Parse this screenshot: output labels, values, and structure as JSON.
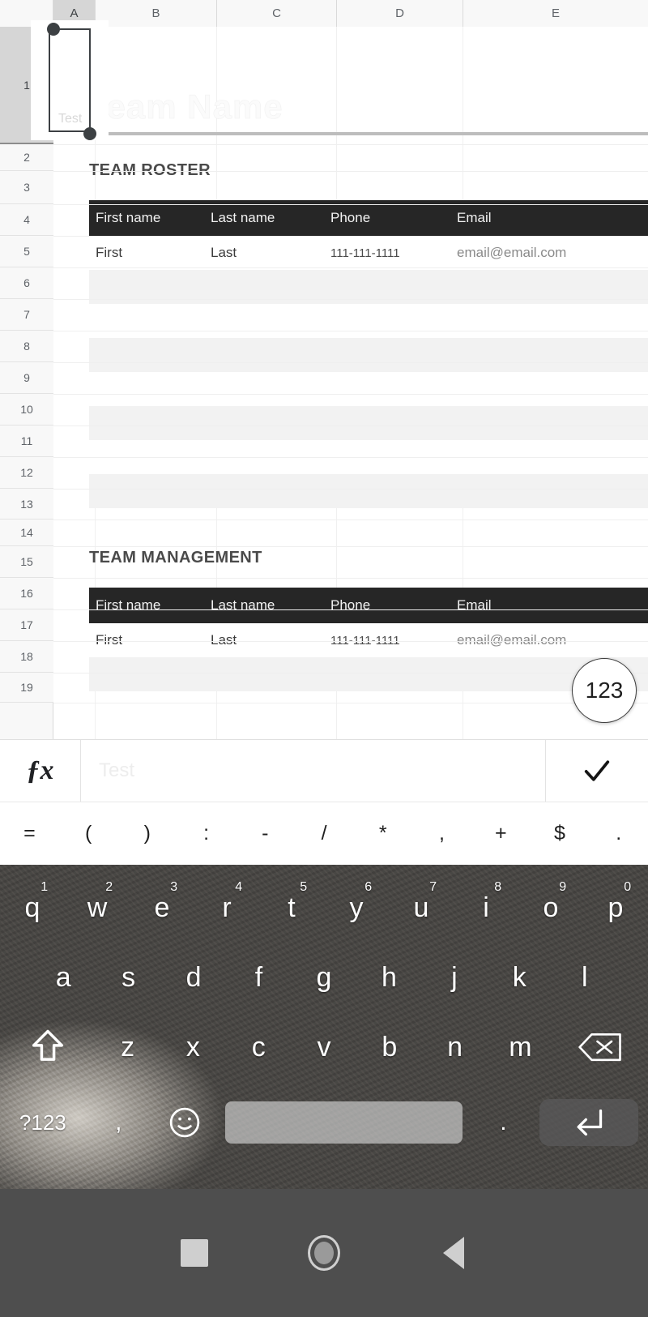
{
  "app": {
    "type": "mobile-spreadsheet-editor"
  },
  "grid": {
    "columns": [
      "A",
      "B",
      "C",
      "D",
      "E"
    ],
    "active_column": "A",
    "rows": [
      "1",
      "2",
      "3",
      "4",
      "5",
      "6",
      "7",
      "8",
      "9",
      "10",
      "11",
      "12",
      "13",
      "14",
      "15",
      "16",
      "17",
      "18",
      "19"
    ],
    "active_row": "1",
    "selected_cell": "A1",
    "selected_cell_value": "Test"
  },
  "template": {
    "title": "Team Name",
    "sections": [
      {
        "heading": "TEAM ROSTER",
        "headers": [
          "First name",
          "Last name",
          "Phone",
          "Email"
        ],
        "rows": [
          [
            "First",
            "Last",
            "111-111-1111",
            "email@email.com"
          ],
          [
            "",
            "",
            "",
            ""
          ],
          [
            "",
            "",
            "",
            ""
          ],
          [
            "",
            "",
            "",
            ""
          ],
          [
            "",
            "",
            "",
            ""
          ],
          [
            "",
            "",
            "",
            ""
          ],
          [
            "",
            "",
            "",
            ""
          ],
          [
            "",
            "",
            "",
            ""
          ]
        ]
      },
      {
        "heading": "TEAM MANAGEMENT",
        "headers": [
          "First name",
          "Last name",
          "Phone",
          "Email"
        ],
        "rows": [
          [
            "First",
            "Last",
            "111-111-1111",
            "email@email.com"
          ],
          [
            "",
            "",
            "",
            ""
          ]
        ]
      }
    ]
  },
  "fab": {
    "label": "123",
    "icon": "numeric-keypad-icon"
  },
  "formula_bar": {
    "fx_label": "ƒx",
    "value": "Test",
    "accept_icon": "checkmark-icon"
  },
  "symbol_row": {
    "symbols": [
      "=",
      "(",
      ")",
      ":",
      "-",
      "/",
      "*",
      ",",
      "+",
      "$",
      "."
    ]
  },
  "keyboard": {
    "layout": "qwerty",
    "row1": [
      {
        "key": "q",
        "num": "1"
      },
      {
        "key": "w",
        "num": "2"
      },
      {
        "key": "e",
        "num": "3"
      },
      {
        "key": "r",
        "num": "4"
      },
      {
        "key": "t",
        "num": "5"
      },
      {
        "key": "y",
        "num": "6"
      },
      {
        "key": "u",
        "num": "7"
      },
      {
        "key": "i",
        "num": "8"
      },
      {
        "key": "o",
        "num": "9"
      },
      {
        "key": "p",
        "num": "0"
      }
    ],
    "row2": [
      "a",
      "s",
      "d",
      "f",
      "g",
      "h",
      "j",
      "k",
      "l"
    ],
    "row3": [
      "z",
      "x",
      "c",
      "v",
      "b",
      "n",
      "m"
    ],
    "shift_icon": "shift-arrow-icon",
    "backspace_icon": "backspace-delete-icon",
    "numeric_toggle": "?123",
    "comma_key": ",",
    "emoji_icon": "smiley-face-icon",
    "space_key": "",
    "period_key": ".",
    "enter_icon": "enter-return-icon"
  },
  "navbar": {
    "recents_icon": "square-recents-icon",
    "home_icon": "circle-home-icon",
    "back_icon": "triangle-back-icon"
  },
  "colors": {
    "table_header_bg": "#262626",
    "alt_row_bg": "#f2f2f2",
    "selection": "#3c4043",
    "navbar_bg": "#4e4e4e"
  }
}
